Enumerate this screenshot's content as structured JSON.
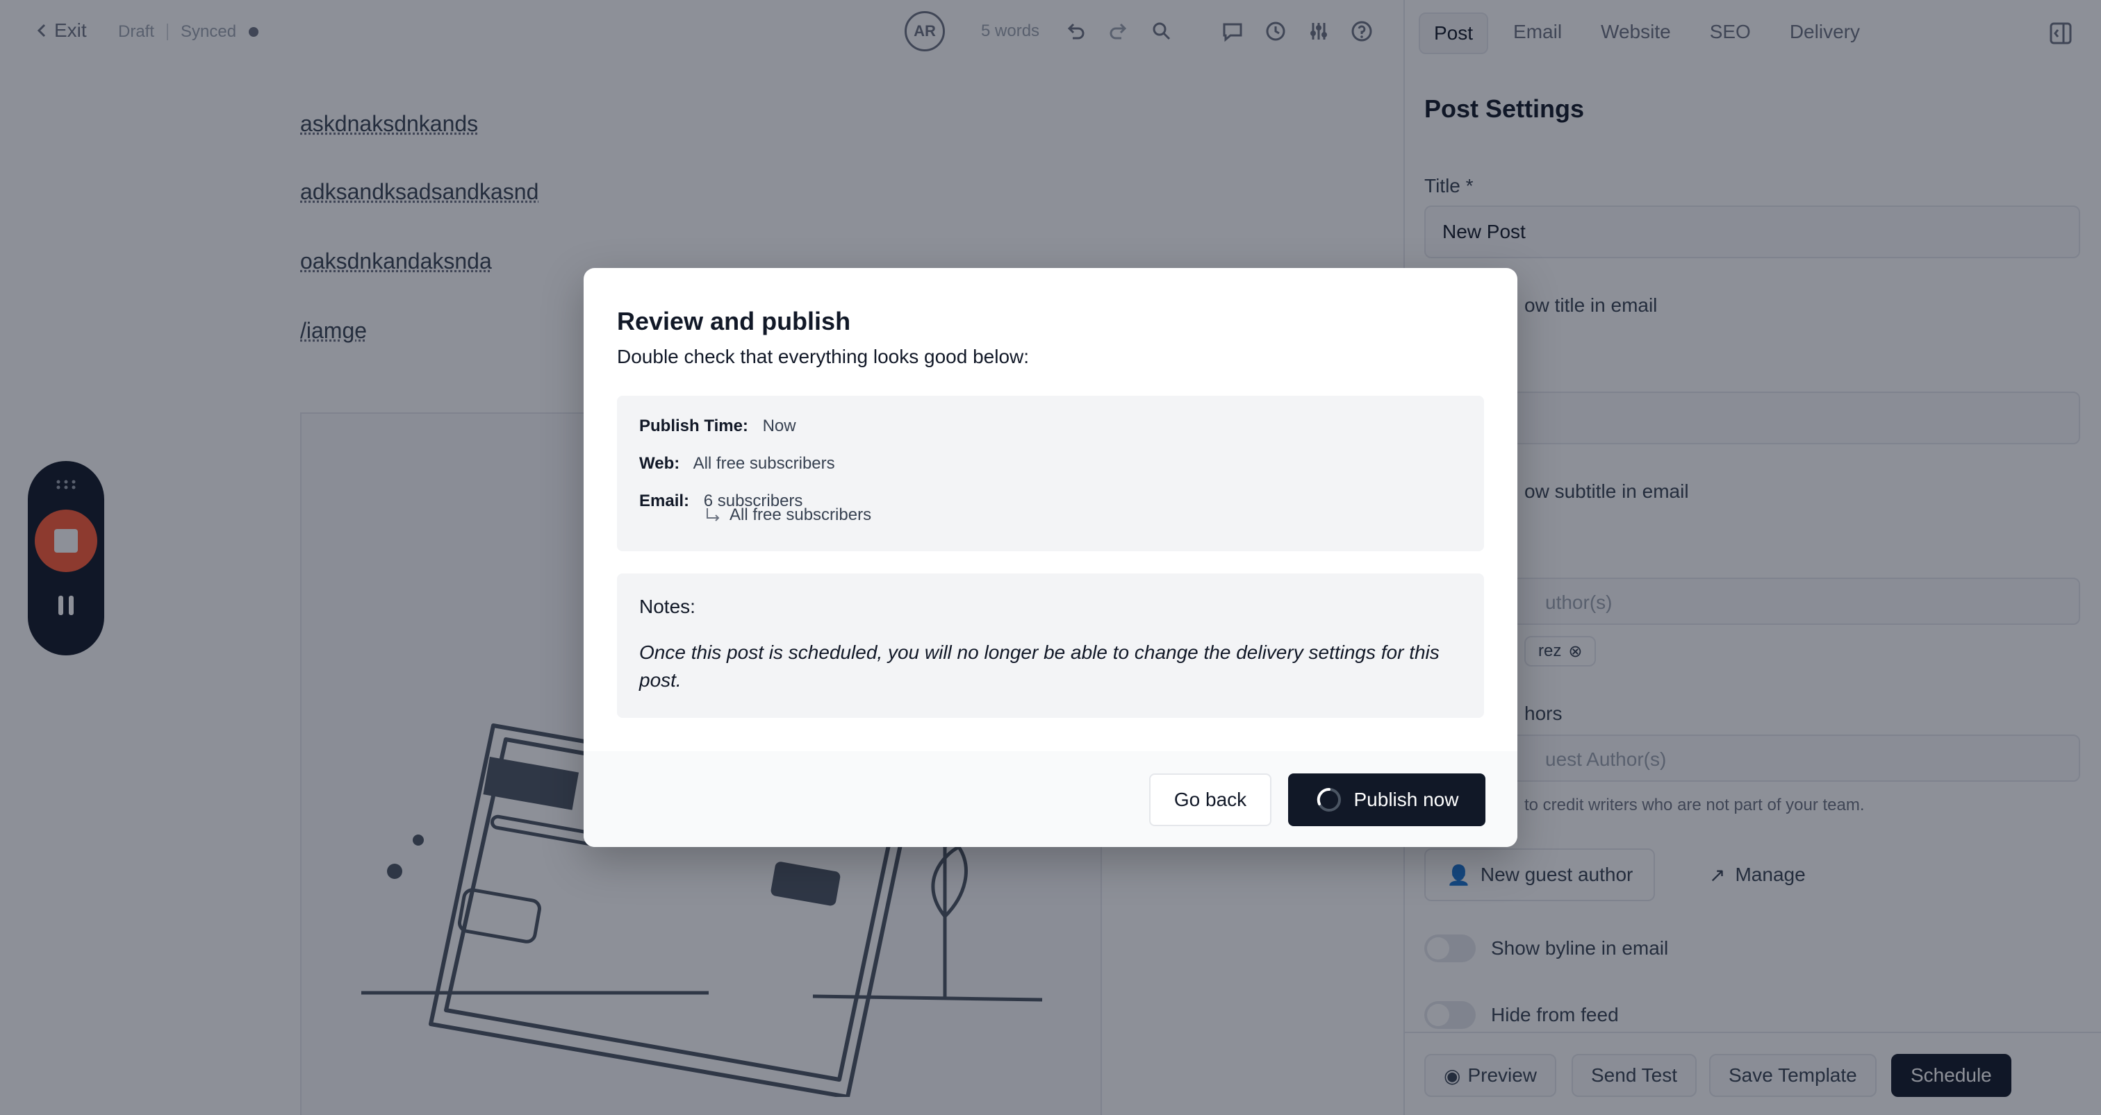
{
  "editor": {
    "exit_label": "Exit",
    "status_draft": "Draft",
    "status_synced": "Synced",
    "avatar_initials": "AR",
    "word_count": "5 words",
    "lines": [
      "askdnaksdnkands",
      "adksandksadsandkasnd",
      "oaksdnkandaksnda",
      "/iamge"
    ]
  },
  "panel": {
    "tabs": [
      "Post",
      "Email",
      "Website",
      "SEO",
      "Delivery"
    ],
    "active_tab": "Post",
    "heading": "Post Settings",
    "title_label": "Title *",
    "title_value": "New Post",
    "show_title_in_email": "ow title in email",
    "show_subtitle_in_email": "ow subtitle in email",
    "authors_placeholder": "uthor(s)",
    "author_chip": "rez",
    "guest_authors_label": "hors",
    "guest_authors_placeholder": "uest Author(s)",
    "guest_helper": "to credit writers who are not part of your team.",
    "new_guest_author": "New guest author",
    "manage": "Manage",
    "show_byline": "Show byline in email",
    "hide_from_feed": "Hide from feed",
    "footer": {
      "preview": "Preview",
      "send_test": "Send Test",
      "save_template": "Save Template",
      "schedule": "Schedule"
    }
  },
  "modal": {
    "title": "Review and publish",
    "subtitle": "Double check that everything looks good below:",
    "publish_time_label": "Publish Time:",
    "publish_time_value": "Now",
    "web_label": "Web:",
    "web_value": "All free subscribers",
    "email_label": "Email:",
    "email_value": "6 subscribers",
    "email_sub_value": "All free subscribers",
    "notes_title": "Notes:",
    "notes_text": "Once this post is scheduled, you will no longer be able to change the delivery settings for this post.",
    "go_back": "Go back",
    "publish_now": "Publish now"
  },
  "colors": {
    "dark": "#111827",
    "record": "#ff5a36",
    "overlay": "#11182780"
  }
}
